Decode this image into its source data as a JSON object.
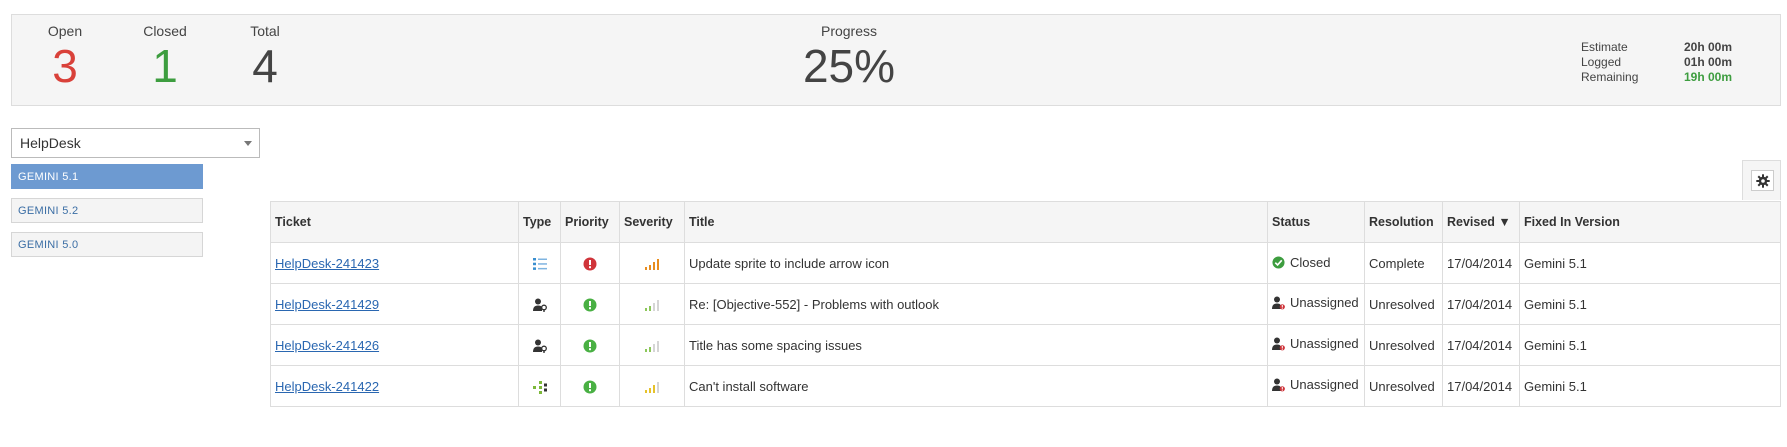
{
  "summary": {
    "open_label": "Open",
    "open_count": "3",
    "closed_label": "Closed",
    "closed_count": "1",
    "total_label": "Total",
    "total_count": "4",
    "progress_label": "Progress",
    "progress_value": "25%",
    "estimate_label": "Estimate",
    "estimate_value": "20h 00m",
    "logged_label": "Logged",
    "logged_value": "01h 00m",
    "remaining_label": "Remaining",
    "remaining_value": "19h 00m"
  },
  "project_select": {
    "value": "HelpDesk"
  },
  "versions": [
    {
      "label": "GEMINI 5.1",
      "active": true
    },
    {
      "label": "GEMINI 5.2",
      "active": false
    },
    {
      "label": "GEMINI 5.0",
      "active": false
    }
  ],
  "table": {
    "columns": {
      "ticket": "Ticket",
      "type": "Type",
      "priority": "Priority",
      "severity": "Severity",
      "title": "Title",
      "status": "Status",
      "resolution": "Resolution",
      "revised": "Revised ▼",
      "fixed_in": "Fixed In Version"
    },
    "rows": [
      {
        "ticket": "HelpDesk-241423",
        "type_icon": "task-list-icon",
        "priority_icon": "priority-high-icon",
        "severity_icon": "severity-high-bars-icon",
        "title": "Update sprite to include arrow icon",
        "status_icon": "check-circle-icon",
        "status": "Closed",
        "resolution": "Complete",
        "revised": "17/04/2014",
        "fixed_in": "Gemini 5.1"
      },
      {
        "ticket": "HelpDesk-241429",
        "type_icon": "user-wrench-icon",
        "priority_icon": "priority-normal-icon",
        "severity_icon": "severity-low-bars-icon",
        "title": "Re: [Objective-552] - Problems with outlook",
        "status_icon": "unassigned-user-icon",
        "status": "Unassigned",
        "resolution": "Unresolved",
        "revised": "17/04/2014",
        "fixed_in": "Gemini 5.1"
      },
      {
        "ticket": "HelpDesk-241426",
        "type_icon": "user-wrench-icon",
        "priority_icon": "priority-normal-icon",
        "severity_icon": "severity-low-bars-icon",
        "title": "Title has some spacing issues",
        "status_icon": "unassigned-user-icon",
        "status": "Unassigned",
        "resolution": "Unresolved",
        "revised": "17/04/2014",
        "fixed_in": "Gemini 5.1"
      },
      {
        "ticket": "HelpDesk-241422",
        "type_icon": "hierarchy-icon",
        "priority_icon": "priority-normal-icon",
        "severity_icon": "severity-medium-bars-icon",
        "title": "Can't install software",
        "status_icon": "unassigned-user-icon",
        "status": "Unassigned",
        "resolution": "Unresolved",
        "revised": "17/04/2014",
        "fixed_in": "Gemini 5.1"
      }
    ]
  },
  "colors": {
    "open": "#d9413a",
    "closed": "#3d9d3f",
    "remaining": "#3d9d3f",
    "link": "#2a67b1",
    "active_version": "#6d9ad1",
    "priority_high": "#d0343a",
    "priority_normal": "#49b043"
  },
  "settings_icon": "gear-icon"
}
